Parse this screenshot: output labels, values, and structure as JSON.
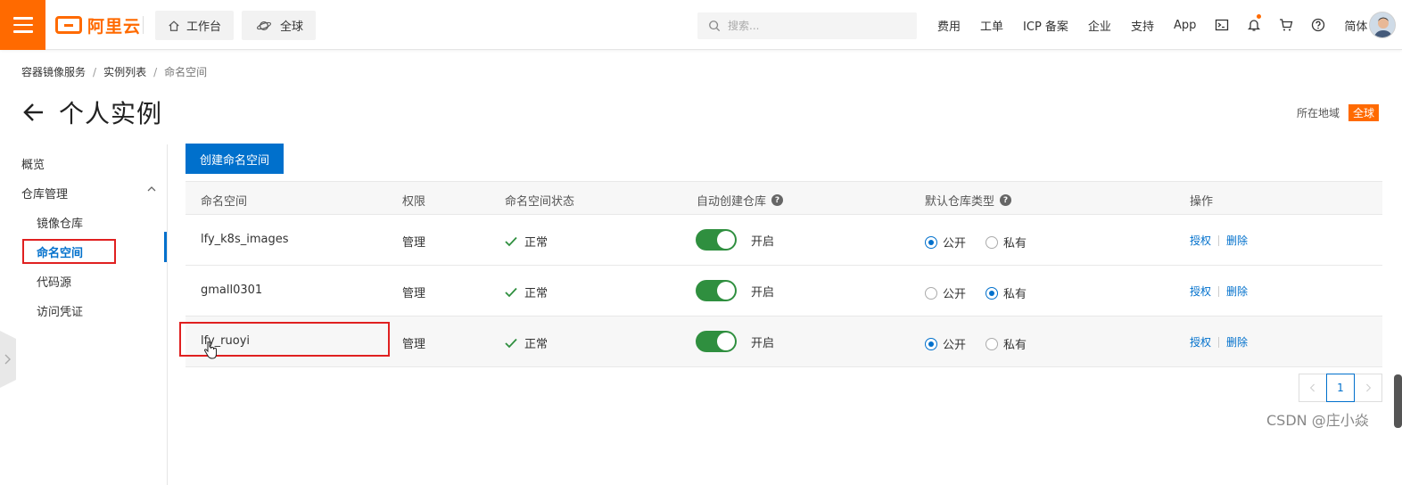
{
  "topbar": {
    "logo_text": "阿里云",
    "workbench": "工作台",
    "global": "全球",
    "search_placeholder": "搜索...",
    "links": [
      "费用",
      "工单",
      "ICP 备案",
      "企业",
      "支持",
      "App"
    ],
    "lang": "简体"
  },
  "breadcrumb": [
    "容器镜像服务",
    "实例列表",
    "命名空间"
  ],
  "page": {
    "title": "个人实例",
    "region_label": "所在地域",
    "region_value": "全球"
  },
  "sidebar": {
    "overview": "概览",
    "repo_mgmt": "仓库管理",
    "sub_items": [
      "镜像仓库",
      "命名空间",
      "代码源",
      "访问凭证"
    ]
  },
  "create_button": "创建命名空间",
  "table": {
    "headers": [
      "命名空间",
      "权限",
      "命名空间状态",
      "自动创建仓库",
      "默认仓库类型",
      "操作"
    ],
    "rows": [
      {
        "name": "lfy_k8s_images",
        "perm": "管理",
        "status": "正常",
        "auto": "开启",
        "public": "公开",
        "private": "私有",
        "selected": "public",
        "op1": "授权",
        "op2": "删除"
      },
      {
        "name": "gmall0301",
        "perm": "管理",
        "status": "正常",
        "auto": "开启",
        "public": "公开",
        "private": "私有",
        "selected": "private",
        "op1": "授权",
        "op2": "删除"
      },
      {
        "name": "lfy_ruoyi",
        "perm": "管理",
        "status": "正常",
        "auto": "开启",
        "public": "公开",
        "private": "私有",
        "selected": "public",
        "op1": "授权",
        "op2": "删除"
      }
    ]
  },
  "pagination": {
    "current": "1"
  },
  "watermark": "CSDN @庄小焱",
  "colors": {
    "brand": "#ff6a00",
    "primary": "#0070cc",
    "toggle_on": "#2f8f3f",
    "highlight": "#e02020"
  }
}
